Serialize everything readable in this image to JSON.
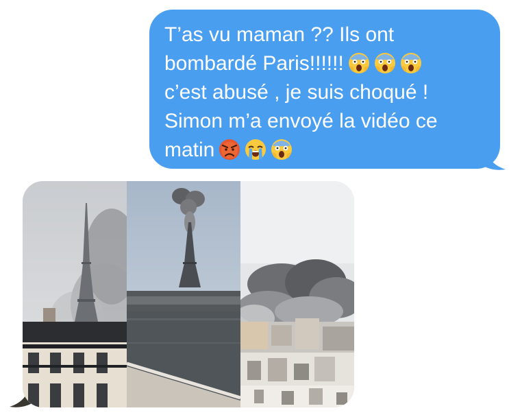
{
  "conversation": {
    "sent_message": {
      "lines": [
        "T’as vu maman ?? Ils ont",
        "bombardé Paris!!!!!!",
        "c’est abusé , je suis choqué !",
        "Simon m’a envoyé la vidéo ce",
        "matin"
      ],
      "line2_emojis": [
        "screaming-face-emoji",
        "screaming-face-emoji",
        "screaming-face-emoji"
      ],
      "line5_emojis": [
        "angry-face-emoji",
        "crying-face-emoji",
        "screaming-face-emoji"
      ],
      "bubble_color": "#4a9ef0",
      "text_color": "#ffffff"
    },
    "received_image": {
      "panels": [
        "eiffel-tower-smoke-photo",
        "eiffel-tower-explosion-photo",
        "paris-skyline-smoke-photo"
      ]
    }
  }
}
